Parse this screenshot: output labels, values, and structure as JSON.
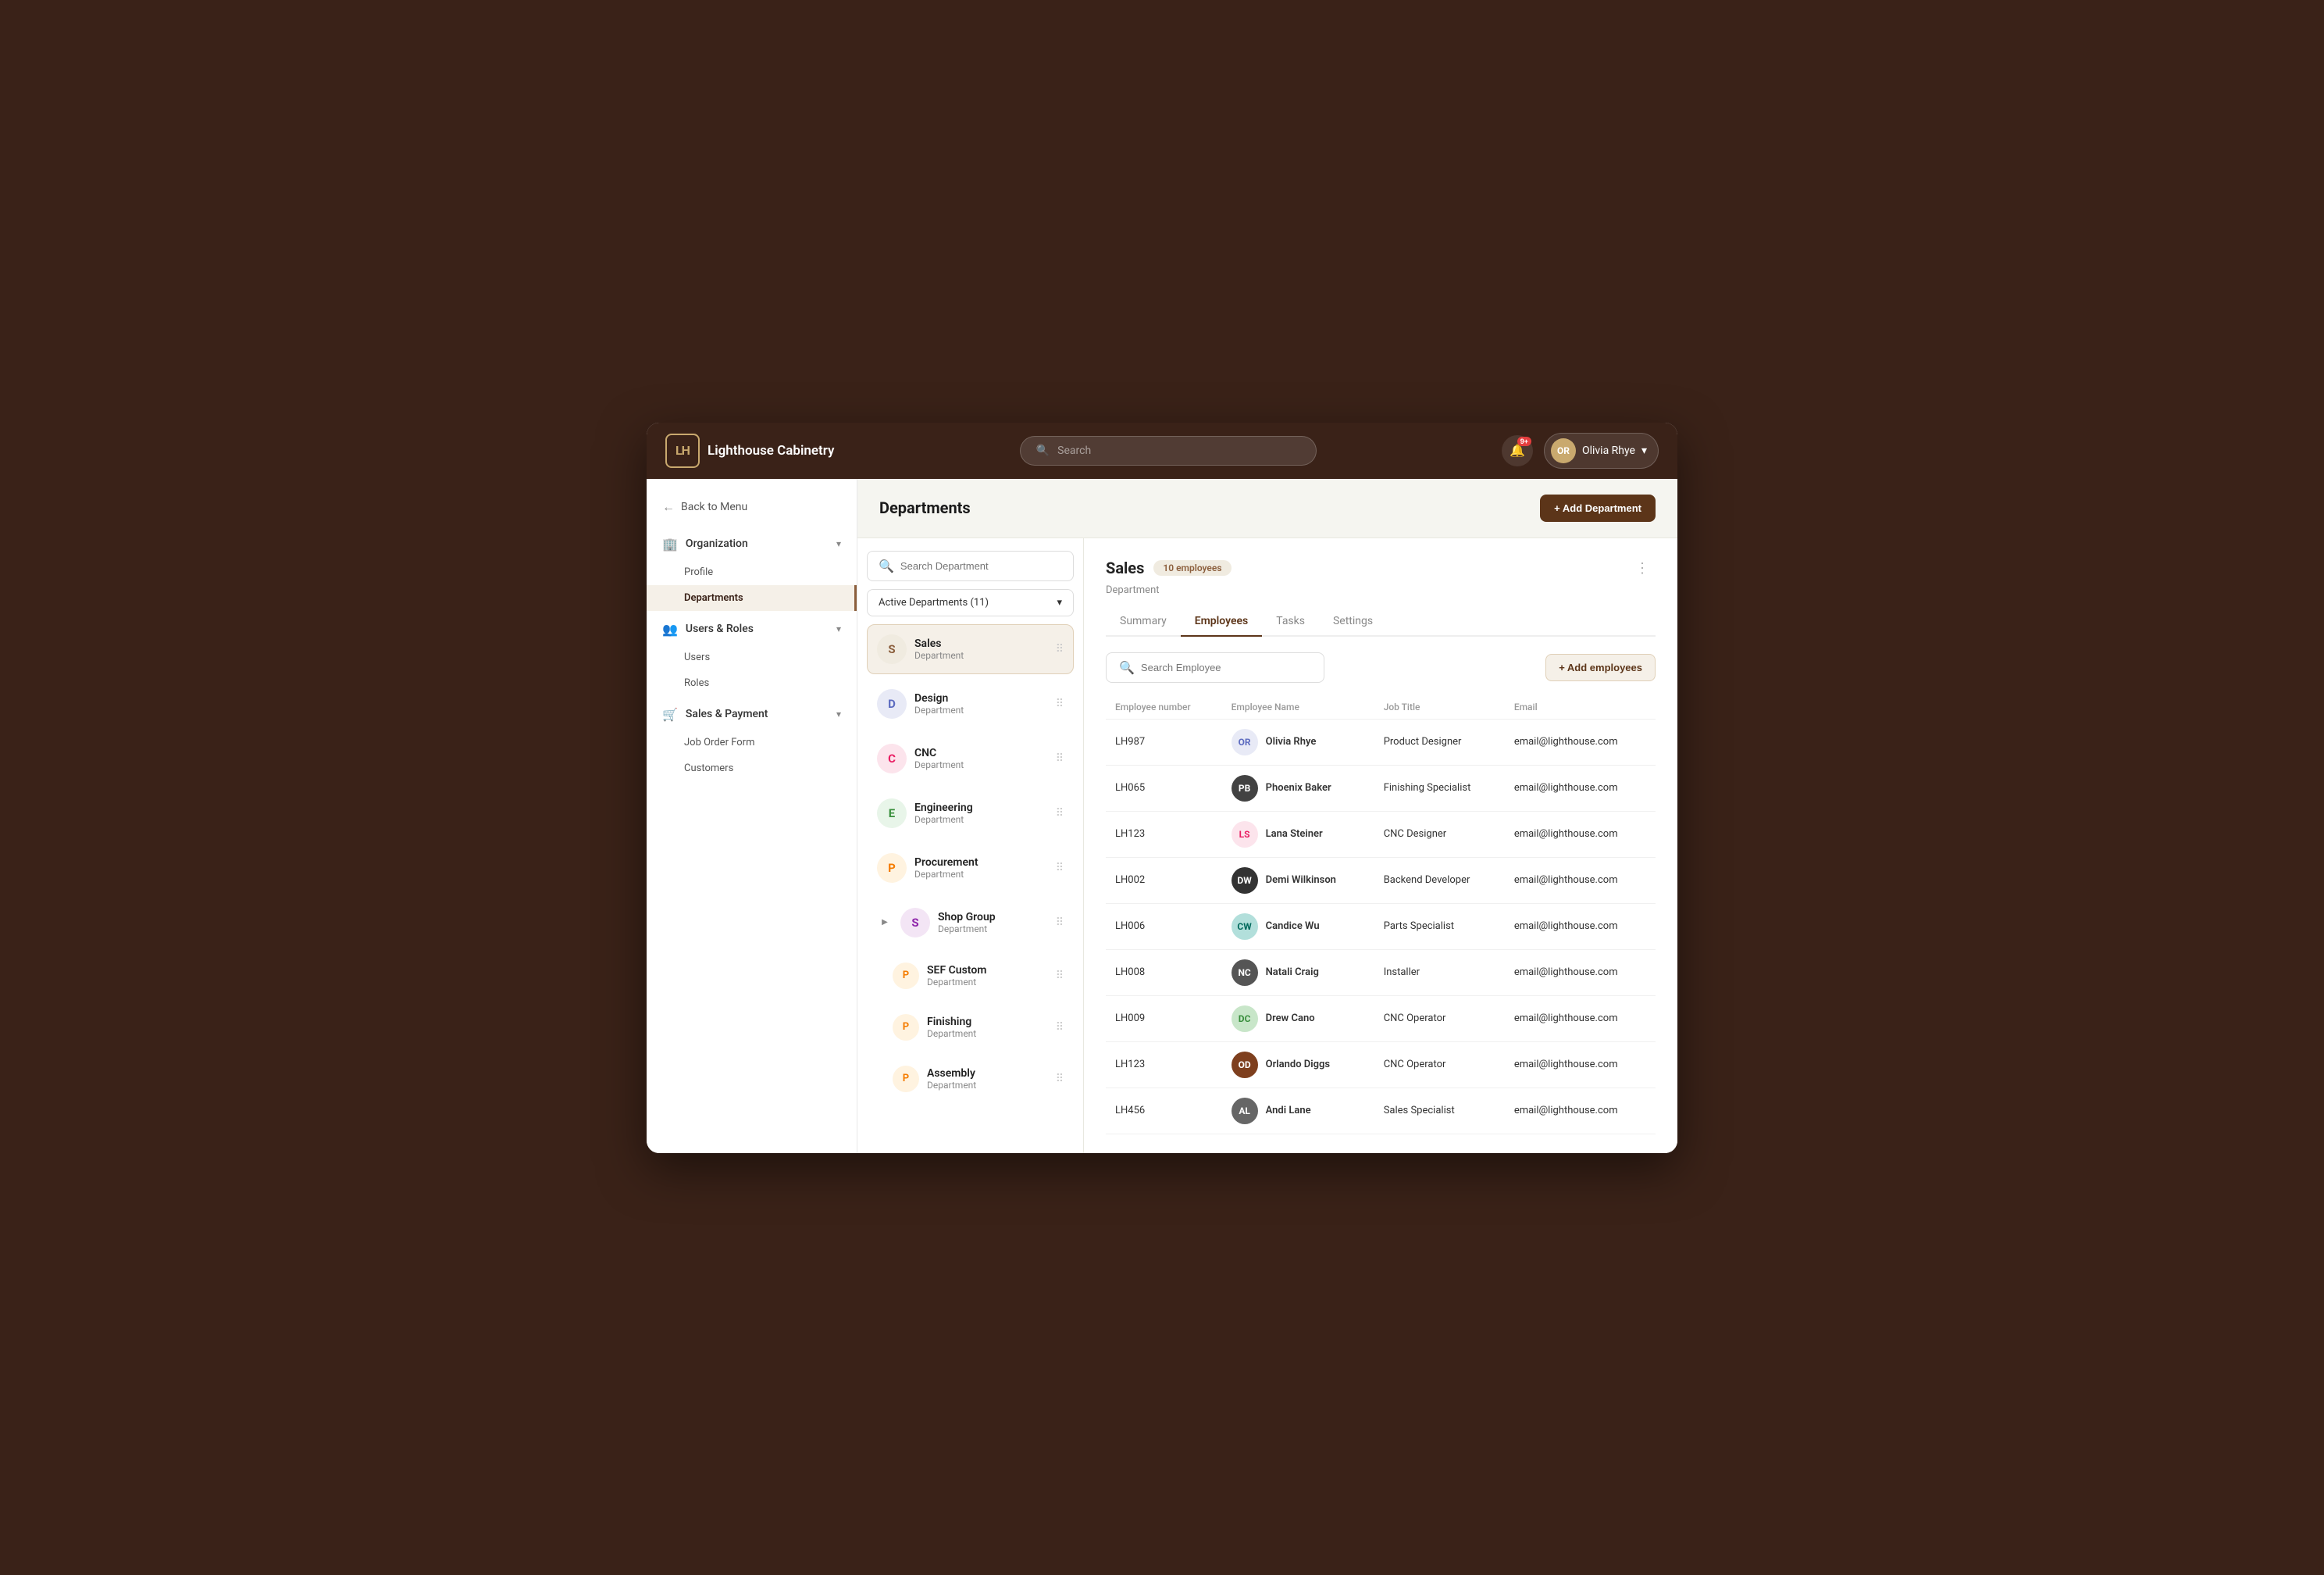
{
  "app": {
    "name": "Lighthouse Cabinetry",
    "logo_initials": "LH"
  },
  "topbar": {
    "search_placeholder": "Search",
    "notif_count": "9+",
    "user_initials": "OR",
    "user_name": "Olivia Rhye"
  },
  "sidebar": {
    "back_label": "Back to Menu",
    "sections": [
      {
        "id": "organization",
        "label": "Organization",
        "icon": "🏢",
        "items": [
          {
            "id": "profile",
            "label": "Profile"
          },
          {
            "id": "departments",
            "label": "Departments",
            "active": true
          }
        ]
      },
      {
        "id": "users-roles",
        "label": "Users & Roles",
        "icon": "👥",
        "items": [
          {
            "id": "users",
            "label": "Users"
          },
          {
            "id": "roles",
            "label": "Roles"
          }
        ]
      },
      {
        "id": "sales-payment",
        "label": "Sales & Payment",
        "icon": "🛒",
        "items": [
          {
            "id": "job-order-form",
            "label": "Job Order Form"
          },
          {
            "id": "customers",
            "label": "Customers"
          }
        ]
      }
    ]
  },
  "departments_page": {
    "title": "Departments",
    "add_button": "+ Add Department",
    "search_placeholder": "Search Department",
    "filter_label": "Active Departments (11)",
    "departments": [
      {
        "id": "sales",
        "initial": "S",
        "name": "Sales",
        "sub": "Department",
        "active": true,
        "color": "#f0ebe0",
        "text": "#8B5E3C"
      },
      {
        "id": "design",
        "initial": "D",
        "name": "Design",
        "sub": "Department",
        "active": false,
        "color": "#e8eaf6",
        "text": "#5c6bc0"
      },
      {
        "id": "cnc",
        "initial": "C",
        "name": "CNC",
        "sub": "Department",
        "active": false,
        "color": "#fce4ec",
        "text": "#e91e63"
      },
      {
        "id": "engineering",
        "initial": "E",
        "name": "Engineering",
        "sub": "Department",
        "active": false,
        "color": "#e8f5e9",
        "text": "#388e3c"
      },
      {
        "id": "procurement",
        "initial": "P",
        "name": "Procurement",
        "sub": "Department",
        "active": false,
        "color": "#fff3e0",
        "text": "#f57c00"
      },
      {
        "id": "shopgroup",
        "initial": "S",
        "name": "Shop Group",
        "sub": "Department",
        "active": false,
        "color": "#f3e5f5",
        "text": "#8e24aa",
        "expandable": true
      },
      {
        "id": "sefcustom",
        "initial": "P",
        "name": "SEF Custom",
        "sub": "Department",
        "active": false,
        "color": "#fff3e0",
        "text": "#f57c00",
        "indent": true
      },
      {
        "id": "finishing",
        "initial": "P",
        "name": "Finishing",
        "sub": "Department",
        "active": false,
        "color": "#fff3e0",
        "text": "#f57c00",
        "indent": true
      },
      {
        "id": "assembly",
        "initial": "P",
        "name": "Assembly",
        "sub": "Department",
        "active": false,
        "color": "#fff3e0",
        "text": "#f57c00",
        "indent": true
      }
    ]
  },
  "detail": {
    "dept_name": "Sales",
    "emp_count": "10 employees",
    "dept_label": "Department",
    "tabs": [
      "Summary",
      "Employees",
      "Tasks",
      "Settings"
    ],
    "active_tab": "Employees",
    "search_placeholder": "Search Employee",
    "add_emp_btn": "+ Add employees",
    "table_headers": [
      "Employee number",
      "Employee Name",
      "Job Title",
      "Email"
    ],
    "employees": [
      {
        "id": "LH987",
        "name": "Olivia Rhye",
        "job": "Product Designer",
        "email": "email@lighthouse.com",
        "avatar_bg": "#e8eaf6",
        "avatar_color": "#5c6bc0",
        "avatar_text": "OR"
      },
      {
        "id": "LH065",
        "name": "Phoenix Baker",
        "job": "Finishing Specialist",
        "email": "email@lighthouse.com",
        "avatar_bg": "#424242",
        "avatar_color": "#fff",
        "avatar_text": "PB"
      },
      {
        "id": "LH123",
        "name": "Lana Steiner",
        "job": "CNC Designer",
        "email": "email@lighthouse.com",
        "avatar_bg": "#fce4ec",
        "avatar_color": "#e91e63",
        "avatar_text": "LS"
      },
      {
        "id": "LH002",
        "name": "Demi Wilkinson",
        "job": "Backend Developer",
        "email": "email@lighthouse.com",
        "avatar_bg": "#333",
        "avatar_color": "#fff",
        "avatar_text": "DW"
      },
      {
        "id": "LH006",
        "name": "Candice Wu",
        "job": "Parts Specialist",
        "email": "email@lighthouse.com",
        "avatar_bg": "#b2dfdb",
        "avatar_color": "#00695c",
        "avatar_text": "CW"
      },
      {
        "id": "LH008",
        "name": "Natali Craig",
        "job": "Installer",
        "email": "email@lighthouse.com",
        "avatar_bg": "#555",
        "avatar_color": "#fff",
        "avatar_text": "NC"
      },
      {
        "id": "LH009",
        "name": "Drew Cano",
        "job": "CNC Operator",
        "email": "email@lighthouse.com",
        "avatar_bg": "#c8e6c9",
        "avatar_color": "#388e3c",
        "avatar_text": "DC"
      },
      {
        "id": "LH123",
        "name": "Orlando Diggs",
        "job": "CNC Operator",
        "email": "email@lighthouse.com",
        "avatar_bg": "#7e3f1e",
        "avatar_color": "#fff",
        "avatar_text": "OD"
      },
      {
        "id": "LH456",
        "name": "Andi Lane",
        "job": "Sales Specialist",
        "email": "email@lighthouse.com",
        "avatar_bg": "#666",
        "avatar_color": "#fff",
        "avatar_text": "AL"
      }
    ]
  }
}
